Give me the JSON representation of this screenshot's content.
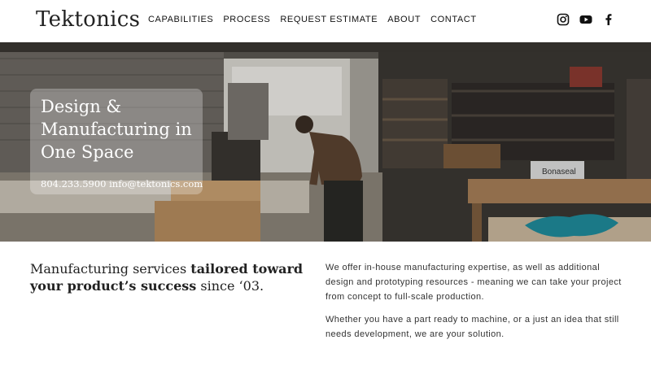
{
  "brand": {
    "logo_text": "Tektonics"
  },
  "nav": {
    "items": [
      {
        "label": "CAPABILITIES"
      },
      {
        "label": "PROCESS"
      },
      {
        "label": "REQUEST ESTIMATE"
      },
      {
        "label": "ABOUT"
      },
      {
        "label": "CONTACT"
      }
    ]
  },
  "social": {
    "icons": [
      "instagram-icon",
      "youtube-icon",
      "facebook-icon"
    ]
  },
  "hero": {
    "title_line1": "Design &",
    "title_line2": "Manufacturing in",
    "title_line3": "One Space",
    "contact": "804.233.5900 info@tektonics.com",
    "box_label": "Bonaseal"
  },
  "intro": {
    "tagline_part1": "Manufacturing services ",
    "tagline_bold": "tailored toward your product’s success",
    "tagline_part2": " since ‘03.",
    "paragraph1": "We offer in-house manufacturing expertise, as well as additional design and prototyping resources - meaning we can take your project from concept to full-scale production.",
    "paragraph2": "Whether you have a part ready to machine, or a just an idea that still needs development, we are your solution."
  },
  "colors": {
    "text": "#1a1a1a",
    "body_text": "#333333",
    "background": "#ffffff"
  }
}
